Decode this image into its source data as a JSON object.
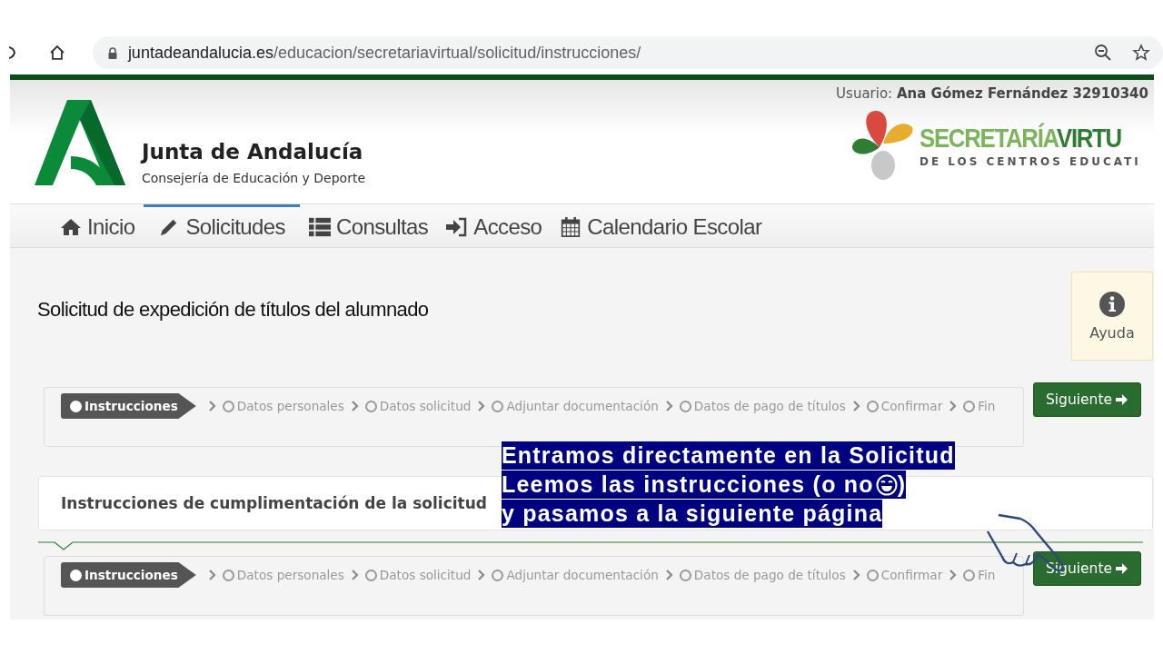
{
  "browser": {
    "url_host": "juntadeandalucia.es",
    "url_path": "/educacion/secretariavirtual/solicitud/instrucciones/"
  },
  "header": {
    "user_label": "Usuario:",
    "user_name": "Ana Gómez Fernández 32910340",
    "org_title": "Junta de Andalucía",
    "org_subtitle": "Consejería de Educación y Deporte",
    "brand_line1a": "SECRETARÍA",
    "brand_line1b": "VIRTU",
    "brand_line2": "DE LOS CENTROS EDUCATI"
  },
  "nav": [
    {
      "label": "Inicio",
      "selected": false
    },
    {
      "label": "Solicitudes",
      "selected": true
    },
    {
      "label": "Consultas",
      "selected": false
    },
    {
      "label": "Acceso",
      "selected": false
    },
    {
      "label": "Calendario Escolar",
      "selected": false
    }
  ],
  "page_title": "Solicitud de expedición de títulos del alumnado",
  "help": {
    "label": "Ayuda"
  },
  "steppers": [
    {
      "steps": [
        {
          "label": "Instrucciones",
          "selected": true
        },
        {
          "label": "Datos personales",
          "selected": false
        },
        {
          "label": "Datos solicitud",
          "selected": false
        },
        {
          "label": "Adjuntar documentación",
          "selected": false
        },
        {
          "label": "Datos de pago de títulos",
          "selected": false
        },
        {
          "label": "Confirmar",
          "selected": false
        },
        {
          "label": "Fin",
          "selected": false
        }
      ],
      "button": "Siguiente"
    },
    {
      "steps": [
        {
          "label": "Instrucciones",
          "selected": true
        },
        {
          "label": "Datos personales",
          "selected": false
        },
        {
          "label": "Datos solicitud",
          "selected": false
        },
        {
          "label": "Adjuntar documentación",
          "selected": false
        },
        {
          "label": "Datos de pago de títulos",
          "selected": false
        },
        {
          "label": "Confirmar",
          "selected": false
        },
        {
          "label": "Fin",
          "selected": false
        }
      ],
      "button": "Siguiente"
    }
  ],
  "instructions_heading": "Instrucciones de cumplimentación de la solicitud",
  "callout": {
    "line1": "Entramos directamente en la Solicitud",
    "line2a": "Leemos las instrucciones (o no",
    "line2b": ")",
    "line3": "y pasamos a la siguiente página"
  }
}
